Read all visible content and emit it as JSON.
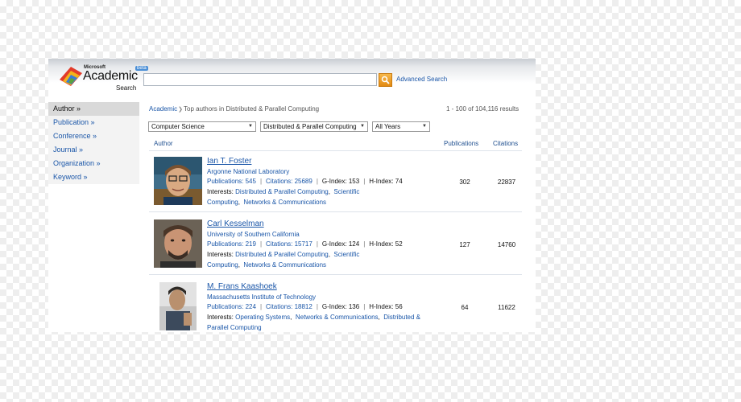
{
  "header": {
    "logo_microsoft": "Microsoft",
    "logo_academic": "Academic",
    "logo_search": "Search",
    "logo_beta": "beta",
    "search_value": "",
    "advanced_search": "Advanced Search"
  },
  "sidebar": {
    "items": [
      {
        "label": "Author »"
      },
      {
        "label": "Publication »"
      },
      {
        "label": "Conference »"
      },
      {
        "label": "Journal »"
      },
      {
        "label": "Organization »"
      },
      {
        "label": "Keyword »"
      }
    ]
  },
  "breadcrumb": {
    "root": "Academic",
    "current": "Top authors in Distributed & Parallel Computing"
  },
  "results_count": "1 - 100 of 104,116 results",
  "filters": {
    "domain": "Computer Science",
    "subdomain": "Distributed & Parallel Computing",
    "years": "All Years"
  },
  "table": {
    "col_author": "Author",
    "col_publications": "Publications",
    "col_citations": "Citations",
    "labels": {
      "g_index": "G-Index:",
      "h_index": "H-Index:",
      "interests": "Interests:"
    },
    "rows": [
      {
        "name": "Ian T. Foster",
        "affiliation": "Argonne National Laboratory",
        "publications_text": "Publications: 545",
        "citations_text": "Citations: 25689",
        "g_index": "153",
        "h_index": "74",
        "interests": [
          "Distributed & Parallel Computing",
          "Scientific Computing",
          "Networks & Communications"
        ],
        "publications": "302",
        "citations": "22837"
      },
      {
        "name": "Carl Kesselman",
        "affiliation": "University of Southern California",
        "publications_text": "Publications: 219",
        "citations_text": "Citations: 15717",
        "g_index": "124",
        "h_index": "52",
        "interests": [
          "Distributed & Parallel Computing",
          "Scientific Computing",
          "Networks & Communications"
        ],
        "publications": "127",
        "citations": "14760"
      },
      {
        "name": "M. Frans Kaashoek",
        "affiliation": "Massachusetts Institute of Technology",
        "publications_text": "Publications: 224",
        "citations_text": "Citations: 18812",
        "g_index": "136",
        "h_index": "56",
        "interests": [
          "Operating Systems",
          "Networks & Communications",
          "Distributed & Parallel Computing"
        ],
        "publications": "64",
        "citations": "11622"
      }
    ]
  },
  "colors": {
    "link": "#1a56a8",
    "search_button": "#e38a12",
    "sidebar_active": "#d9d9d9"
  },
  "icons": {
    "logo": "academic-logo-icon",
    "search": "magnifier-icon",
    "breadcrumb_separator": "chevron-right-icon",
    "dropdown": "caret-down-icon"
  }
}
